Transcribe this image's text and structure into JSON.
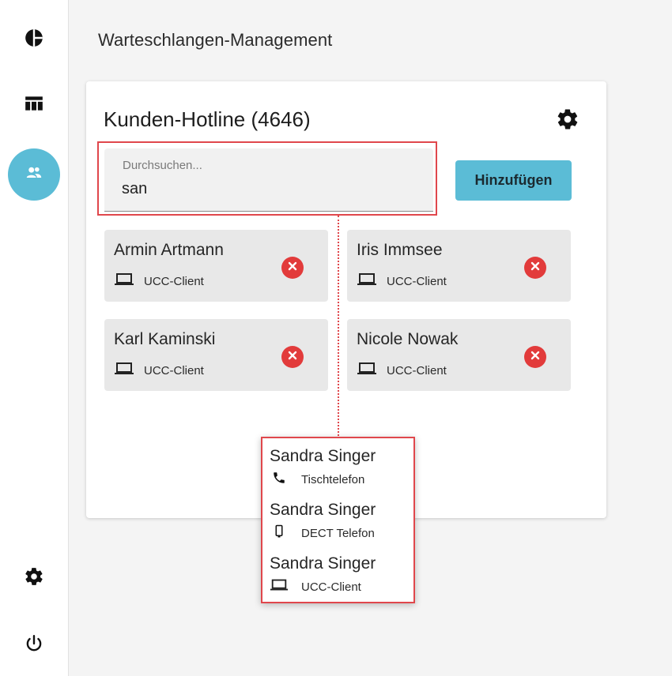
{
  "sidebar": {
    "items": [
      {
        "icon": "pie-chart-icon",
        "active": false
      },
      {
        "icon": "table-icon",
        "active": false
      },
      {
        "icon": "people-icon",
        "active": true
      },
      {
        "icon": "gear-icon",
        "active": false
      },
      {
        "icon": "power-icon",
        "active": false
      }
    ]
  },
  "page": {
    "title": "Warteschlangen-Management"
  },
  "queue": {
    "title": "Kunden-Hotline (4646)"
  },
  "search": {
    "label": "Durchsuchen...",
    "value": "san"
  },
  "add_button": {
    "label": "Hinzufügen"
  },
  "members": [
    {
      "name": "Armin Artmann",
      "device": "UCC-Client",
      "device_icon": "laptop-icon"
    },
    {
      "name": "Iris Immsee",
      "device": "UCC-Client",
      "device_icon": "laptop-icon"
    },
    {
      "name": "Karl Kaminski",
      "device": "UCC-Client",
      "device_icon": "laptop-icon"
    },
    {
      "name": "Nicole Nowak",
      "device": "UCC-Client",
      "device_icon": "laptop-icon"
    }
  ],
  "suggestions": [
    {
      "name": "Sandra Singer",
      "device": "Tischtelefon",
      "device_icon": "phone-icon"
    },
    {
      "name": "Sandra Singer",
      "device": "DECT Telefon",
      "device_icon": "mobile-phone-icon"
    },
    {
      "name": "Sandra Singer",
      "device": "UCC-Client",
      "device_icon": "laptop-icon"
    }
  ],
  "colors": {
    "accent": "#5bbcd6",
    "highlight": "#e0474c",
    "remove": "#e23b3b"
  }
}
